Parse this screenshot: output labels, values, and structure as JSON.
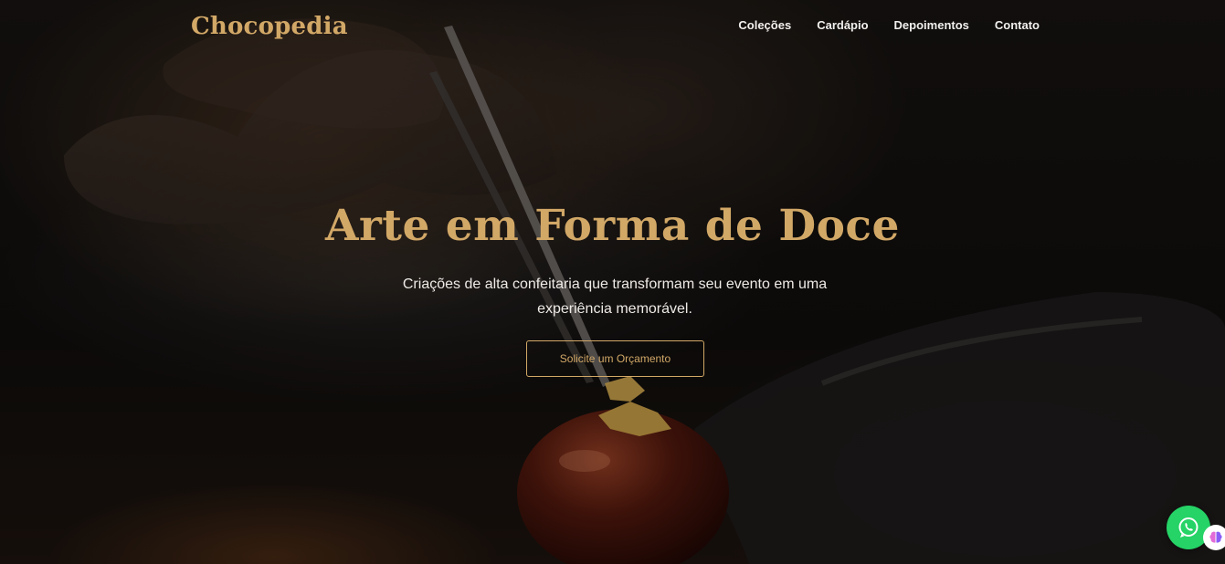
{
  "brand": {
    "name": "Chocopedia",
    "color": "#d2a867"
  },
  "nav": {
    "items": [
      {
        "label": "Coleções"
      },
      {
        "label": "Cardápio"
      },
      {
        "label": "Depoimentos"
      },
      {
        "label": "Contato"
      }
    ]
  },
  "hero": {
    "title": "Arte em Forma de Doce",
    "subtitle": "Criações de alta confeitaria que transformam seu evento em uma experiência memorável.",
    "cta_label": "Solicite um Orçamento",
    "background": "photo-chocolate-bonbon-gold-leaf-tweezers"
  },
  "floating": {
    "whatsapp_icon": "whatsapp-icon",
    "whatsapp_color": "#25d366",
    "extension_icon": "brain-icon"
  }
}
